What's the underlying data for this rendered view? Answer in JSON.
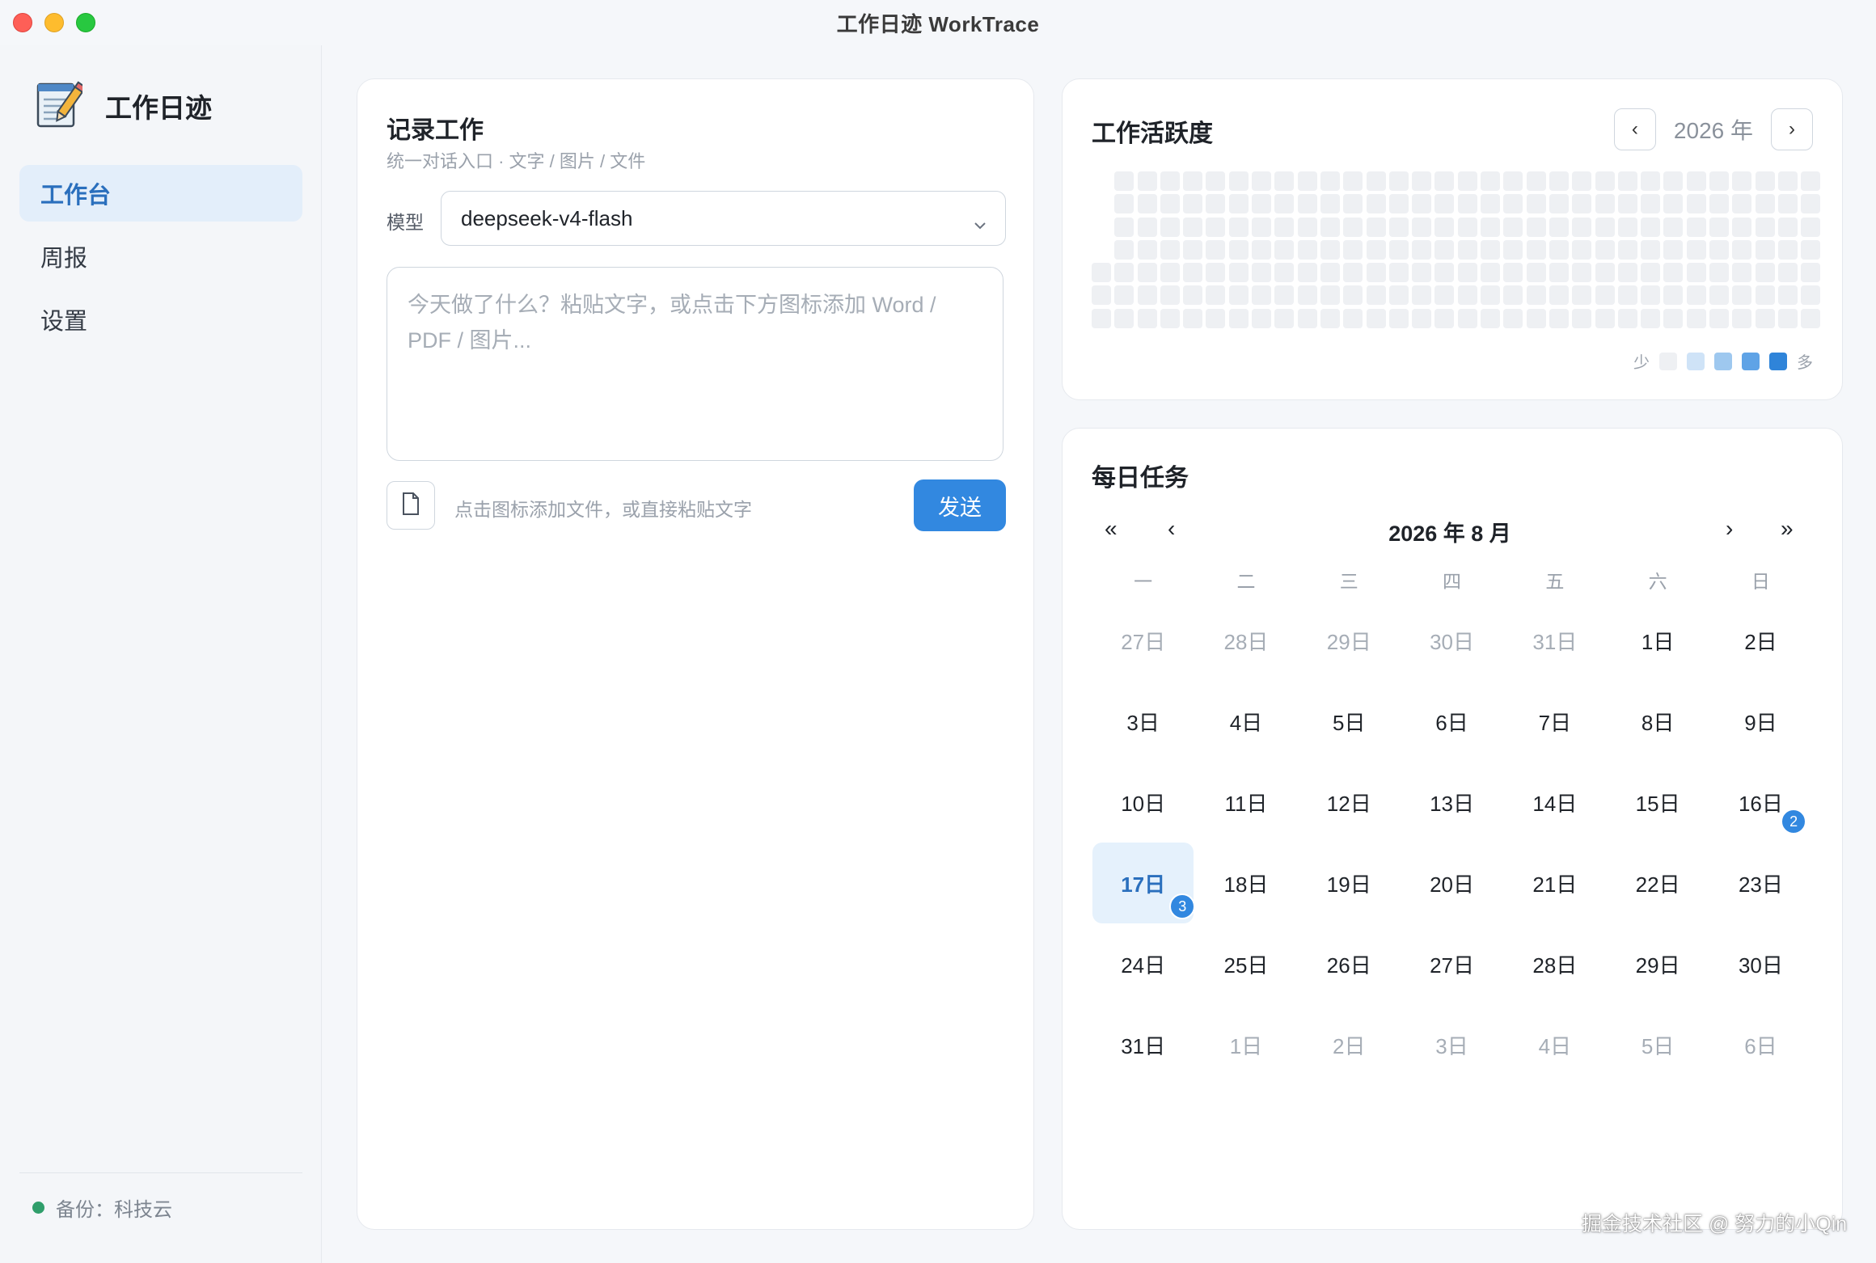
{
  "window": {
    "title": "工作日迹 WorkTrace"
  },
  "sidebar": {
    "brand": "工作日迹",
    "items": [
      {
        "label": "工作台",
        "active": true,
        "key": "workbench"
      },
      {
        "label": "周报",
        "active": false,
        "key": "weekly"
      },
      {
        "label": "设置",
        "active": false,
        "key": "settings"
      }
    ],
    "backup_label": "备份：科技云",
    "backup_status_color": "#2f9e6b"
  },
  "record": {
    "title": "记录工作",
    "subtitle": "统一对话入口 · 文字 / 图片 / 文件",
    "model_label": "模型",
    "model_value": "deepseek-v4-flash",
    "input_placeholder": "今天做了什么？粘贴文字，或点击下方图标添加 Word / PDF / 图片...",
    "attach_hint": "点击图标添加文件，或直接粘贴文字",
    "send_label": "发送"
  },
  "activity": {
    "title": "工作活跃度",
    "year_label": "2026 年",
    "prev_icon": "‹",
    "next_icon": "›",
    "legend_less": "少",
    "legend_more": "多",
    "legend_colors": [
      "#eef0f3",
      "#cfe3f7",
      "#9ec8ef",
      "#5fa3e6",
      "#2f84d9"
    ]
  },
  "daily": {
    "title": "每日任务",
    "month_label": "2026 年 8 月",
    "nav": {
      "prev_year": "«",
      "prev_month": "‹",
      "next_month": "›",
      "next_year": "»"
    },
    "weekdays": [
      "一",
      "二",
      "三",
      "四",
      "五",
      "六",
      "日"
    ],
    "days": [
      {
        "label": "27日",
        "muted": true
      },
      {
        "label": "28日",
        "muted": true
      },
      {
        "label": "29日",
        "muted": true
      },
      {
        "label": "30日",
        "muted": true
      },
      {
        "label": "31日",
        "muted": true
      },
      {
        "label": "1日"
      },
      {
        "label": "2日"
      },
      {
        "label": "3日"
      },
      {
        "label": "4日"
      },
      {
        "label": "5日"
      },
      {
        "label": "6日"
      },
      {
        "label": "7日"
      },
      {
        "label": "8日"
      },
      {
        "label": "9日"
      },
      {
        "label": "10日"
      },
      {
        "label": "11日"
      },
      {
        "label": "12日"
      },
      {
        "label": "13日"
      },
      {
        "label": "14日"
      },
      {
        "label": "15日"
      },
      {
        "label": "16日",
        "badge": "2"
      },
      {
        "label": "17日",
        "today": true,
        "badge": "3"
      },
      {
        "label": "18日"
      },
      {
        "label": "19日"
      },
      {
        "label": "20日"
      },
      {
        "label": "21日"
      },
      {
        "label": "22日"
      },
      {
        "label": "23日"
      },
      {
        "label": "24日"
      },
      {
        "label": "25日"
      },
      {
        "label": "26日"
      },
      {
        "label": "27日"
      },
      {
        "label": "28日"
      },
      {
        "label": "29日"
      },
      {
        "label": "30日"
      },
      {
        "label": "31日"
      },
      {
        "label": "1日",
        "muted": true
      },
      {
        "label": "2日",
        "muted": true
      },
      {
        "label": "3日",
        "muted": true
      },
      {
        "label": "4日",
        "muted": true
      },
      {
        "label": "5日",
        "muted": true
      },
      {
        "label": "6日",
        "muted": true
      }
    ]
  },
  "watermark": "掘金技术社区 @ 努力的小Qin"
}
